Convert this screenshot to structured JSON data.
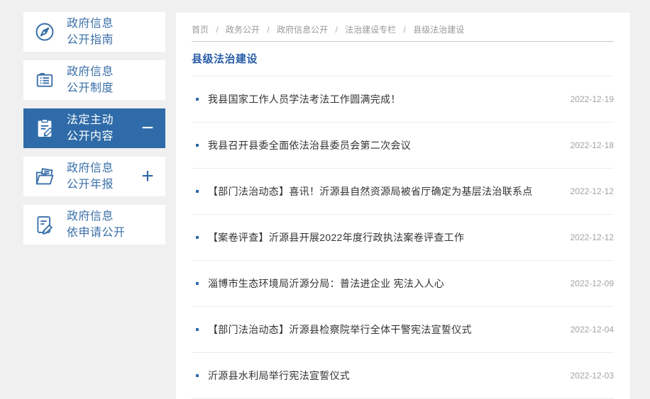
{
  "colors": {
    "accent": "#2e6ba8",
    "page_bg": "#f0f0f0",
    "card_bg": "#ffffff",
    "title_blue": "#2a5da8",
    "article_text": "#333333",
    "muted_text": "#9b9b9b",
    "divider": "#ededed"
  },
  "sidebar": {
    "items": [
      {
        "line1": "政府信息",
        "line2": "公开指南",
        "icon": "compass-icon",
        "active": false,
        "toggle": ""
      },
      {
        "line1": "政府信息",
        "line2": "公开制度",
        "icon": "ledger-icon",
        "active": false,
        "toggle": ""
      },
      {
        "line1": "法定主动",
        "line2": "公开内容",
        "icon": "clipboard-pencil-icon",
        "active": true,
        "toggle": "−"
      },
      {
        "line1": "政府信息",
        "line2": "公开年报",
        "icon": "folder-icon",
        "active": false,
        "toggle": "+"
      },
      {
        "line1": "政府信息",
        "line2": "依申请公开",
        "icon": "paper-pencil-icon",
        "active": false,
        "toggle": ""
      }
    ]
  },
  "breadcrumb": {
    "separator": "/",
    "items": [
      "首页",
      "政务公开",
      "政府信息公开",
      "法治建设专栏",
      "县级法治建设"
    ]
  },
  "main": {
    "section_title": "县级法治建设",
    "articles": [
      {
        "title": "我县国家工作人员学法考法工作圆满完成！",
        "date": "2022-12-19"
      },
      {
        "title": "我县召开县委全面依法治县委员会第二次会议",
        "date": "2022-12-18"
      },
      {
        "title": "【部门法治动态】喜讯！沂源县自然资源局被省厅确定为基层法治联系点",
        "date": "2022-12-12"
      },
      {
        "title": "【案卷评查】沂源县开展2022年度行政执法案卷评查工作",
        "date": "2022-12-12"
      },
      {
        "title": "淄博市生态环境局沂源分局：普法进企业 宪法入人心",
        "date": "2022-12-09"
      },
      {
        "title": "【部门法治动态】沂源县检察院举行全体干警宪法宣誓仪式",
        "date": "2022-12-04"
      },
      {
        "title": "沂源县水利局举行宪法宣誓仪式",
        "date": "2022-12-03"
      }
    ]
  }
}
